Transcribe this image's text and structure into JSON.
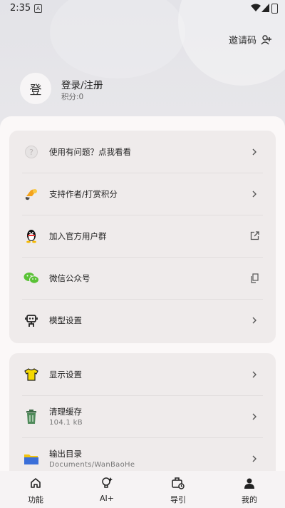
{
  "status_bar": {
    "time": "2:35",
    "notification_glyph": "A"
  },
  "header": {
    "invite_label": "邀请码",
    "avatar_text": "登",
    "login_label": "登录/注册",
    "points_label": "积分:0"
  },
  "menu_group_1": [
    {
      "label": "使用有问题？点我看看",
      "icon": "question-icon",
      "trail": "chevron-right-icon"
    },
    {
      "label": "支持作者/打赏积分",
      "icon": "tip-hand-icon",
      "trail": "chevron-right-icon"
    },
    {
      "label": "加入官方用户群",
      "icon": "qq-penguin-icon",
      "trail": "external-link-icon"
    },
    {
      "label": "微信公众号",
      "icon": "wechat-icon",
      "trail": "copy-icon"
    },
    {
      "label": "模型设置",
      "icon": "robot-icon",
      "trail": "chevron-right-icon"
    }
  ],
  "menu_group_2": [
    {
      "label": "显示设置",
      "icon": "tshirt-icon",
      "trail": "chevron-right-icon"
    },
    {
      "label": "清理缓存",
      "sub": "104.1 kB",
      "icon": "trash-icon",
      "trail": "chevron-right-icon"
    },
    {
      "label": "输出目录",
      "sub": "Documents/WanBaoHe",
      "icon": "folder-icon",
      "trail": "chevron-right-icon"
    }
  ],
  "bottom_nav": [
    {
      "label": "功能",
      "icon": "home-icon"
    },
    {
      "label": "AI+",
      "icon": "bulb-icon"
    },
    {
      "label": "导引",
      "icon": "briefcase-clock-icon"
    },
    {
      "label": "我的",
      "icon": "person-icon"
    }
  ],
  "colors": {
    "accent_yellow": "#f5d800",
    "wechat_green": "#5ac236",
    "folder_blue": "#3b6fd9",
    "trash_green": "#4f8a5a"
  }
}
